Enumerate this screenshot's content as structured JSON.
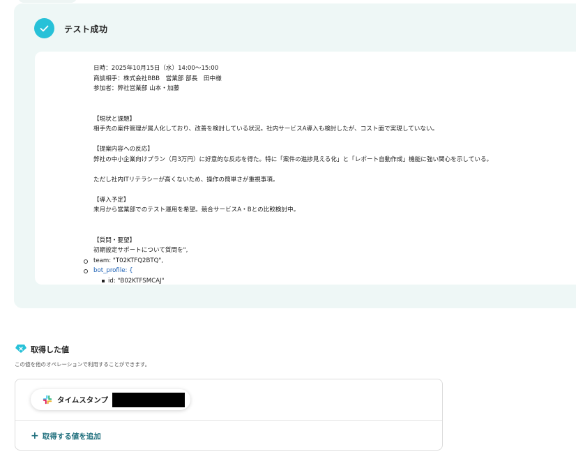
{
  "test_result": {
    "title": "テスト成功",
    "lines": [
      "日時：2025年10月15日（水）14:00〜15:00",
      "商談相手：株式会社BBB　営業部 部長　田中様",
      "参加者：弊社営業部 山本・加藤",
      "",
      "",
      "【現状と課題】",
      "相手先の案件管理が属人化しており、改善を検討している状況。社内サービスA導入も検討したが、コスト面で実現していない。",
      "",
      "【提案内容への反応】",
      "弊社の中小企業向けプラン（月3万円）に好意的な反応を得た。特に「案件の進捗見える化」と「レポート自動作成」機能に強い関心を示している。",
      "",
      "ただし社内ITリテラシーが高くないため、操作の簡単さが重視事項。",
      "",
      "【導入予定】",
      "来月から営業部でのテスト運用を希望。競合サービスA・Bとの比較検討中。",
      "",
      "",
      "【質問・要望】",
      "初期設定サポートについて質問を\","
    ],
    "json_items": [
      {
        "key": "team",
        "text": "team: \"T02KTFQ2BTQ\","
      },
      {
        "key": "bot_profile",
        "text": "bot_profile: {"
      }
    ],
    "sub_item": "id: \"B02KTFSMCAJ\""
  },
  "acquired": {
    "title": "取得した値",
    "description": "この値を他のオペレーションで利用することができます。",
    "items": [
      {
        "label": "タイムスタンプ",
        "icon": "slack-icon"
      }
    ],
    "add_label": "取得する値を追加",
    "add_icon": "plus-icon"
  },
  "colors": {
    "accent": "#27c1d8",
    "panel_bg": "#eef7f6",
    "link": "#1f6f7d"
  }
}
